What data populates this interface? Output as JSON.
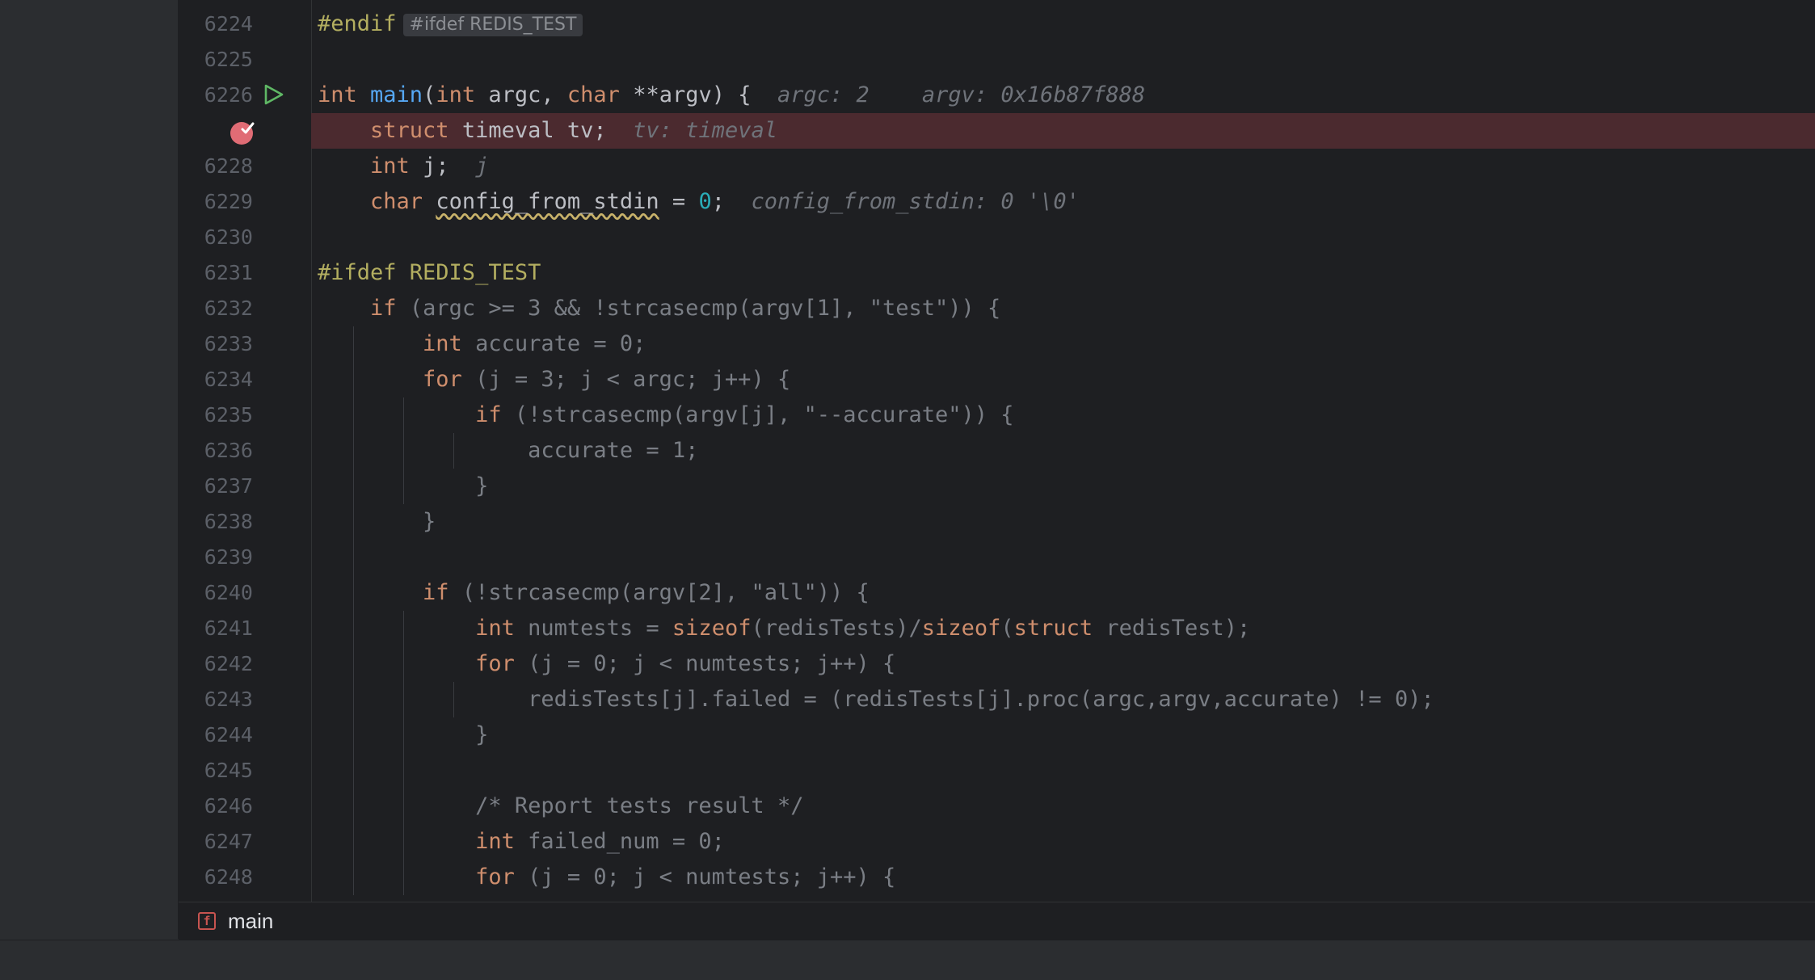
{
  "gutter": {
    "line_numbers": [
      "6224",
      "6225",
      "6226",
      "",
      "6228",
      "6229",
      "6230",
      "6231",
      "6232",
      "6233",
      "6234",
      "6235",
      "6236",
      "6237",
      "6238",
      "6239",
      "6240",
      "6241",
      "6242",
      "6243",
      "6244",
      "6245",
      "6246",
      "6247",
      "6248"
    ]
  },
  "breadcrumb": {
    "label": "main",
    "badge": "f"
  },
  "colors": {
    "breakpoint": "#e06c75",
    "run": "#5fb865",
    "highlight": "#4b2a2f"
  },
  "code": [
    [
      {
        "t": "macro",
        "v": "#endif"
      },
      {
        "t": "chip",
        "v": "#ifdef REDIS_TEST"
      }
    ],
    [],
    [
      {
        "t": "kw",
        "v": "int "
      },
      {
        "t": "fn",
        "v": "main"
      },
      {
        "t": "plain",
        "v": "("
      },
      {
        "t": "kw",
        "v": "int "
      },
      {
        "t": "plain",
        "v": "argc, "
      },
      {
        "t": "kw",
        "v": "char "
      },
      {
        "t": "plain",
        "v": "**argv) {"
      },
      {
        "t": "hint",
        "v": "  argc: 2    argv: 0x16b87f888"
      }
    ],
    [
      {
        "t": "plain",
        "v": "    "
      },
      {
        "t": "kw",
        "v": "struct "
      },
      {
        "t": "plain",
        "v": "timeval tv;"
      },
      {
        "t": "hint",
        "v": "  tv: timeval"
      }
    ],
    [
      {
        "t": "plain",
        "v": "    "
      },
      {
        "t": "kw",
        "v": "int "
      },
      {
        "t": "plain",
        "v": "j;"
      },
      {
        "t": "hint",
        "v": "  j"
      }
    ],
    [
      {
        "t": "plain",
        "v": "    "
      },
      {
        "t": "kw",
        "v": "char "
      },
      {
        "t": "squiggle",
        "v": "config_from_stdin"
      },
      {
        "t": "plain",
        "v": " = "
      },
      {
        "t": "num",
        "v": "0"
      },
      {
        "t": "plain",
        "v": ";"
      },
      {
        "t": "hint",
        "v": "  config_from_stdin: 0 '\\0'"
      }
    ],
    [],
    [
      {
        "t": "macro",
        "v": "#ifdef REDIS_TEST"
      }
    ],
    [
      {
        "t": "ip",
        "v": "    "
      },
      {
        "t": "kw",
        "v": "if "
      },
      {
        "t": "ip",
        "v": "(argc >= 3 && !strcasecmp(argv[1], \"test\")) {"
      }
    ],
    [
      {
        "t": "ip",
        "v": "        "
      },
      {
        "t": "kw",
        "v": "int "
      },
      {
        "t": "ip",
        "v": "accurate = 0;"
      }
    ],
    [
      {
        "t": "ip",
        "v": "        "
      },
      {
        "t": "kw",
        "v": "for "
      },
      {
        "t": "ip",
        "v": "(j = 3; j < argc; j++) {"
      }
    ],
    [
      {
        "t": "ip",
        "v": "            "
      },
      {
        "t": "kw",
        "v": "if "
      },
      {
        "t": "ip",
        "v": "(!strcasecmp(argv[j], \"--accurate\")) {"
      }
    ],
    [
      {
        "t": "ip",
        "v": "                accurate = 1;"
      }
    ],
    [
      {
        "t": "ip",
        "v": "            }"
      }
    ],
    [
      {
        "t": "ip",
        "v": "        }"
      }
    ],
    [],
    [
      {
        "t": "ip",
        "v": "        "
      },
      {
        "t": "kw",
        "v": "if "
      },
      {
        "t": "ip",
        "v": "(!strcasecmp(argv[2], \"all\")) {"
      }
    ],
    [
      {
        "t": "ip",
        "v": "            "
      },
      {
        "t": "kw",
        "v": "int "
      },
      {
        "t": "ip",
        "v": "numtests = "
      },
      {
        "t": "kw",
        "v": "sizeof"
      },
      {
        "t": "ip",
        "v": "(redisTests)/"
      },
      {
        "t": "kw",
        "v": "sizeof"
      },
      {
        "t": "ip",
        "v": "("
      },
      {
        "t": "kw",
        "v": "struct "
      },
      {
        "t": "ip",
        "v": "redisTest);"
      }
    ],
    [
      {
        "t": "ip",
        "v": "            "
      },
      {
        "t": "kw",
        "v": "for "
      },
      {
        "t": "ip",
        "v": "(j = 0; j < numtests; j++) {"
      }
    ],
    [
      {
        "t": "ip",
        "v": "                redisTests[j].failed = (redisTests[j].proc(argc,argv,accurate) != 0);"
      }
    ],
    [
      {
        "t": "ip",
        "v": "            }"
      }
    ],
    [],
    [
      {
        "t": "ip",
        "v": "            /* Report tests result */"
      }
    ],
    [
      {
        "t": "ip",
        "v": "            "
      },
      {
        "t": "kw",
        "v": "int "
      },
      {
        "t": "ip",
        "v": "failed_num = 0;"
      }
    ],
    [
      {
        "t": "ip",
        "v": "            "
      },
      {
        "t": "kw",
        "v": "for "
      },
      {
        "t": "ip",
        "v": "(j = 0; j < numtests; j++) {"
      }
    ]
  ]
}
